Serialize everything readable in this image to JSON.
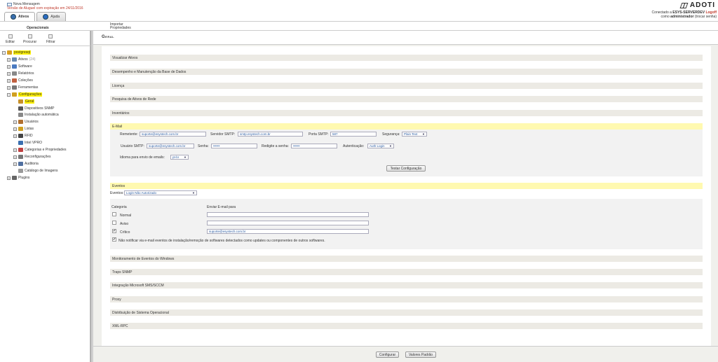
{
  "header": {
    "new_message": "Nova Mensagem",
    "license": "Versão de Aluguel com expiração em 24/11/2016",
    "tabs": [
      {
        "label": "Ativos"
      },
      {
        "label": "Ajuda"
      }
    ],
    "logo": "ADOTI",
    "connected_prefix": "Conectado a",
    "server": "ESYS-SERVERDEV",
    "logoff": "Logoff",
    "as_prefix": "como",
    "user": "administrador",
    "change_password": "(trocar senha)"
  },
  "subbar": {
    "operacionais": "Operacionais",
    "importar": "Importar Propriedades"
  },
  "toolbar": {
    "edit": "Editar",
    "search": "Procurar",
    "filter": "Filtrar"
  },
  "tree": {
    "root": "postgresql",
    "items": [
      {
        "label": "Ativos",
        "count": "(24)"
      },
      {
        "label": "Software"
      },
      {
        "label": "Relatórios"
      },
      {
        "label": "Coleções"
      },
      {
        "label": "Ferramentas"
      },
      {
        "label": "Configurações"
      },
      {
        "label": "Geral"
      },
      {
        "label": "Dispositivos SNMP"
      },
      {
        "label": "Instalação automática"
      },
      {
        "label": "Usuários"
      },
      {
        "label": "Listas"
      },
      {
        "label": "RFID"
      },
      {
        "label": "Intel VPRO"
      },
      {
        "label": "Categorias e Propriedades"
      },
      {
        "label": "Reconfigurações"
      },
      {
        "label": "Auditoria"
      },
      {
        "label": "Catálogo de Imagens"
      },
      {
        "label": "Plugins"
      }
    ]
  },
  "main": {
    "title": "Geral",
    "sections": [
      "Visualizar Ativos",
      "Desempenho e Manutenção da Base de Dados",
      "Licença",
      "Pesquisa de Ativos de Rede",
      "Inventários",
      "E-Mail",
      "Eventos",
      "Monitoramento de Eventos do Windows",
      "Traps SNMP",
      "Integração Microsoft SMS/SCCM",
      "Proxy",
      "Distribuição de Sistema Operacional",
      "XML-RPC"
    ],
    "email": {
      "sender_label": "Remetente:",
      "sender_value": "suporte@esystech.com.br",
      "smtp_label": "Servidor SMTP:",
      "smtp_value": "smtp.esystech.com.br",
      "port_label": "Porta SMTP:",
      "port_value": "587",
      "security_label": "Segurança:",
      "security_value": "Plain Text",
      "user_label": "Usuário SMTP:",
      "user_value": "suporte@esystech.com.br",
      "password_label": "Senha:",
      "password_value": "••••••",
      "retype_label": "Redigite a senha:",
      "retype_value": "••••••",
      "auth_label": "Autenticação:",
      "auth_value": "Auth Login",
      "lang_label": "Idioma para envio de emails:",
      "lang_value": "pt-br",
      "test_button": "Testar Configuração"
    },
    "events": {
      "events_label": "Eventos:",
      "events_value": "Login Não Autorizado",
      "category_header": "Categoria",
      "send_header": "Enviar E-mail para",
      "rows": [
        {
          "label": "Normal",
          "checked": "",
          "value": ""
        },
        {
          "label": "Aviso",
          "checked": "",
          "value": ""
        },
        {
          "label": "Crítico",
          "checked": "✔",
          "value": "suporte@esystech.com.br"
        }
      ],
      "notify_check": "✔",
      "notify_text": "Não notificar via e-mail eventos de instalação/remoção de softwares detectados como updates ou componentes de outros softwares."
    },
    "footer": {
      "save": "Configurar",
      "defaults": "Valores Padrão"
    }
  },
  "colors": {
    "highlight": "#fff200",
    "section": "#eceae4",
    "license": "#c0392b"
  }
}
